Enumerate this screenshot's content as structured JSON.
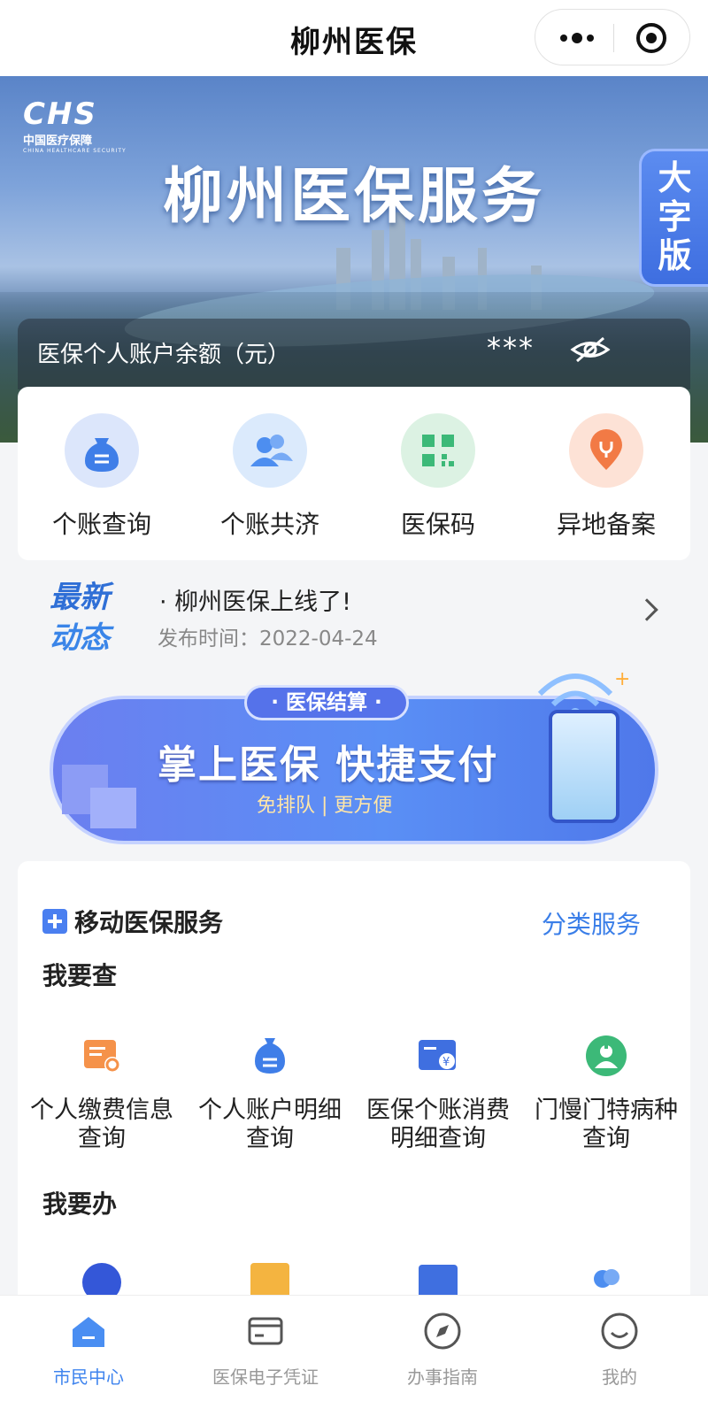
{
  "header": {
    "title": "柳州医保"
  },
  "banner": {
    "logo_mark": "CHS",
    "logo_cn": "中国医疗保障",
    "logo_en": "CHINA HEALTHCARE SECURITY",
    "title": "柳州医保服务",
    "big_font_label": "大字版",
    "balance_label": "医保个人账户余额（元）",
    "balance_masked": "***"
  },
  "quick_actions": [
    {
      "label": "个账查询",
      "icon": "money-bag-icon",
      "color": "#dce6fb"
    },
    {
      "label": "个账共济",
      "icon": "people-icon",
      "color": "#dbeafc"
    },
    {
      "label": "医保码",
      "icon": "qr-code-icon",
      "color": "#dcf2e3"
    },
    {
      "label": "异地备案",
      "icon": "location-pin-icon",
      "color": "#fde2d6"
    }
  ],
  "news": {
    "tag_line1": "最新",
    "tag_line2": "动态",
    "title": "· 柳州医保上线了!",
    "date": "发布时间：2022-04-24"
  },
  "promo": {
    "tag": "· 医保结算 ·",
    "headline": "掌上医保  快捷支付",
    "sub": "免排队  |  更方便"
  },
  "services": {
    "title": "移动医保服务",
    "more": "分类服务",
    "query_title": "我要查",
    "query_items": [
      {
        "label": "个人缴费信息查询",
        "icon": "payment-doc-icon",
        "color": "#f5924a"
      },
      {
        "label": "个人账户明细查询",
        "icon": "money-bag-icon",
        "color": "#3f7ee8"
      },
      {
        "label": "医保个账消费明细查询",
        "icon": "yuan-card-icon",
        "color": "#3f6fe0"
      },
      {
        "label": "门慢门特病种查询",
        "icon": "doctor-icon",
        "color": "#3cb978"
      }
    ],
    "handle_title": "我要办",
    "handle_items": [
      {
        "label": "",
        "icon": "stethoscope-icon",
        "color": "#3457d8"
      },
      {
        "label": "",
        "icon": "city-icon",
        "color": "#f4b440"
      },
      {
        "label": "",
        "icon": "insurance-card-icon",
        "color": "#3f6fe0"
      },
      {
        "label": "",
        "icon": "people-icon",
        "color": "#4d8ef0"
      }
    ]
  },
  "tabbar": [
    {
      "label": "市民中心",
      "icon": "home-icon",
      "active": true
    },
    {
      "label": "医保电子凭证",
      "icon": "card-icon",
      "active": false
    },
    {
      "label": "办事指南",
      "icon": "compass-icon",
      "active": false
    },
    {
      "label": "我的",
      "icon": "smile-icon",
      "active": false
    }
  ]
}
